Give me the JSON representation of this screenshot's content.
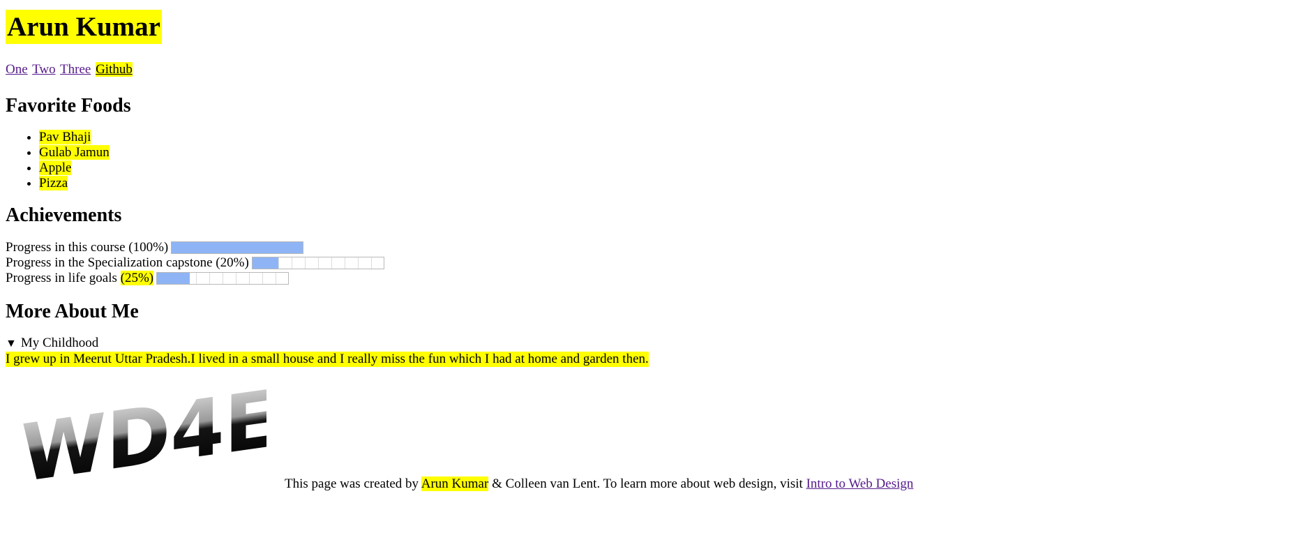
{
  "header": {
    "title": "Arun Kumar"
  },
  "nav": {
    "links": [
      "One",
      "Two",
      "Three",
      "Github"
    ]
  },
  "foods": {
    "heading": "Favorite Foods",
    "items": [
      "Pav Bhaji",
      "Gulab Jamun",
      "Apple",
      "Pizza"
    ]
  },
  "achievements": {
    "heading": "Achievements",
    "items": [
      {
        "label": "Progress in this course",
        "pct_text": "(100%)",
        "value": 1.0
      },
      {
        "label": "Progress in the Specialization capstone",
        "pct_text": "(20%)",
        "value": 0.2
      },
      {
        "label": "Progress in life goals",
        "pct_text": "(25%)",
        "value": 0.25
      }
    ]
  },
  "about": {
    "heading": "More About Me",
    "summary": "My Childhood",
    "text": "I grew up in Meerut Uttar Pradesh.I lived in a small house and I really miss the fun which I had at home and garden then."
  },
  "logo": {
    "text": "WD4E"
  },
  "footer": {
    "prefix": "This page was created by",
    "author": "Arun Kumar",
    "middle": "& Colleen van Lent. To learn more about web design, visit",
    "link": "Intro to Web Design"
  },
  "colors": {
    "highlight": "#ffff00",
    "visited_link": "#551a8b",
    "progress_fill": "#8eb4f5"
  },
  "icons": {
    "disclosure": "triangle-down-icon"
  }
}
